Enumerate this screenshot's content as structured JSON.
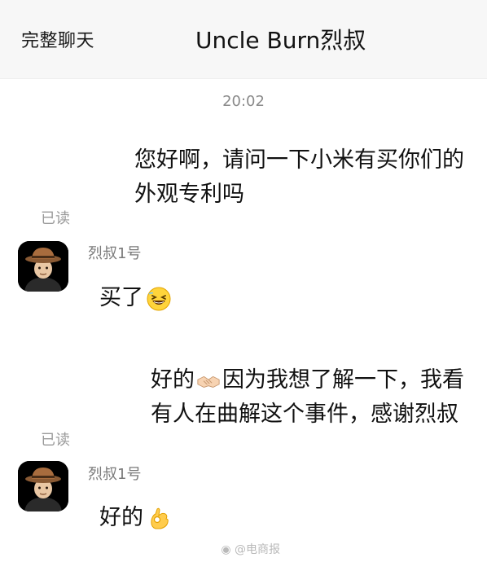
{
  "header": {
    "back_label": "完整聊天",
    "title": "Uncle Burn烈叔"
  },
  "chat": {
    "timestamp": "20:02",
    "messages": [
      {
        "direction": "sent",
        "lines": [
          "您好啊，请问一下小米有买你们的",
          "外观专利吗"
        ],
        "status": "已读"
      },
      {
        "direction": "received",
        "sender": "烈叔1号",
        "text": "买了",
        "emoji": "grinning-squint-face-emoji"
      },
      {
        "direction": "sent",
        "line1_before": "好的",
        "line1_emoji": "handshake-emoji",
        "line1_after": "因为我想了解一下，我看",
        "line2": "有人在曲解这个事件，感谢烈叔",
        "status": "已读"
      },
      {
        "direction": "received",
        "sender": "烈叔1号",
        "text": "好的",
        "emoji": "ok-hand-emoji"
      }
    ]
  },
  "watermark": {
    "text": "@电商报"
  },
  "colors": {
    "header_bg": "#f7f7f7",
    "avatar_bg": "#000000",
    "muted_text": "#8a8a8a"
  }
}
